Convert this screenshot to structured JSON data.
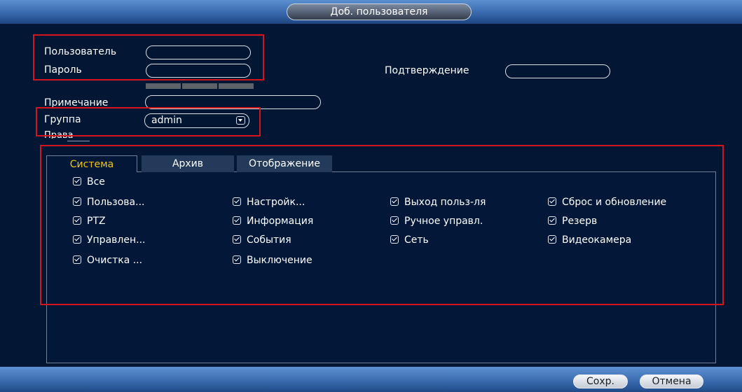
{
  "dialog": {
    "title": "Доб. пользователя"
  },
  "form": {
    "user_label": "Пользователь",
    "user_value": "",
    "password_label": "Пароль",
    "password_value": "",
    "confirm_label": "Подтверждение",
    "confirm_value": "",
    "note_label": "Примечание",
    "note_value": "",
    "group_label": "Группа",
    "group_value": "admin",
    "rights_label": "Права"
  },
  "tabs": [
    {
      "label": "Система",
      "active": true
    },
    {
      "label": "Архив",
      "active": false
    },
    {
      "label": "Отображение",
      "active": false
    }
  ],
  "permissions": {
    "all": "Все",
    "items": [
      "Пользова...",
      "Настройк...",
      "Выход польз-ля",
      "Сброс и обновление",
      "PTZ",
      "Информация",
      "Ручное управл.",
      "Резерв",
      "Управлен...",
      "События",
      "Сеть",
      "Видеокамера",
      "Очистка ...",
      "Выключение"
    ]
  },
  "buttons": {
    "save": "Сохр.",
    "cancel": "Отмена"
  },
  "colors": {
    "background": "#031633",
    "header": "#3565a8",
    "highlight": "#d3161d",
    "active_tab_text": "#f0c419"
  }
}
